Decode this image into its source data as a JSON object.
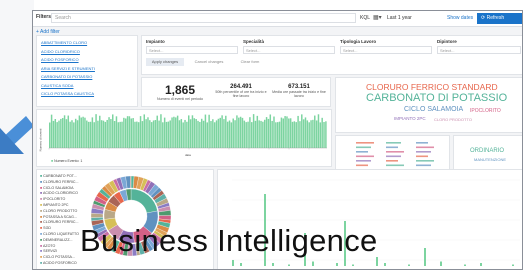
{
  "filter_bar": {
    "label": "Filters",
    "search_placeholder": "Search",
    "kql": "KQL",
    "time_range": "Last 1 year",
    "show_dates": "Show dates",
    "refresh": "Refresh"
  },
  "add_filter": "+ Add filter",
  "sidebar_list": [
    "ABBATTIMENTO CLORO",
    "ACIDO CLORIDRICO",
    "ACIDO FOSFORICO",
    "ARIA SERVIZI E STRUMENTI",
    "CARBONATO DI POTASSIO",
    "CAUSTICA SODA",
    "CICLO POTASSA CAUSTICA"
  ],
  "controls": {
    "impianto": "Impianto",
    "specialita": "Specialità",
    "tipologia": "Tipologia Lavoro",
    "dipintore": "Dipintore",
    "select_placeholder": "Select...",
    "apply": "Apply changes",
    "cancel": "Cancel changes",
    "clear": "Clear form"
  },
  "metrics": [
    {
      "value": "1,865",
      "label": "Numero di eventi nel periodo"
    },
    {
      "value": "264.491",
      "label": "50th percentile of ore tra inizio e fine lavoro"
    },
    {
      "value": "673.151",
      "label": "Media ore passate tra inizio e fine lavoro"
    }
  ],
  "cloud_words": [
    {
      "text": "CLORURO FERRICO STANDARD",
      "color": "#e7664c",
      "size": 8.5
    },
    {
      "text": "CARBONATO DI POTASSIO",
      "color": "#54b399",
      "size": 11
    },
    {
      "text": "CICLO SALAMOIA",
      "color": "#6092c0",
      "size": 7
    },
    {
      "text": "IPOCLORITO",
      "color": "#d36086",
      "size": 5
    },
    {
      "text": "IMPIANTO 2PC",
      "color": "#9170b8",
      "size": 4.5
    },
    {
      "text": "CLORO PRODOTTO",
      "color": "#ca8eae",
      "size": 4
    },
    {
      "text": "ORDINARIO",
      "color": "#54b399",
      "size": 6
    },
    {
      "text": "MANUTENZIONE",
      "color": "#6092c0",
      "size": 4
    }
  ],
  "bar_chart": {
    "x_label": "data",
    "y_label": "Numero di eventi",
    "legend": "Numero Evento: 1"
  },
  "pie_legend": [
    "CARBONATO POT...",
    "CLORURO FERRIC...",
    "CICLO SALAMOIA",
    "ACIDO CLORIDRICO",
    "IPOCLORITO",
    "IMPIANTO 2PC",
    "CLORO PRODOTTO",
    "POTASSA A SCAG...",
    "CLORURO FERRIC...",
    "SGD",
    "CLORO LIQUEFATTO",
    "DEMINERALIZZ...",
    "AZOTO",
    "SERVIZI",
    "CICLO POTASSA...",
    "ACIDO FOSFORICO"
  ],
  "colors": {
    "green_bar": "#7cd4a0",
    "accent_blue": "#1a73c9",
    "arrow": "#4a8fd8"
  },
  "banner": "Business Intelligence"
}
